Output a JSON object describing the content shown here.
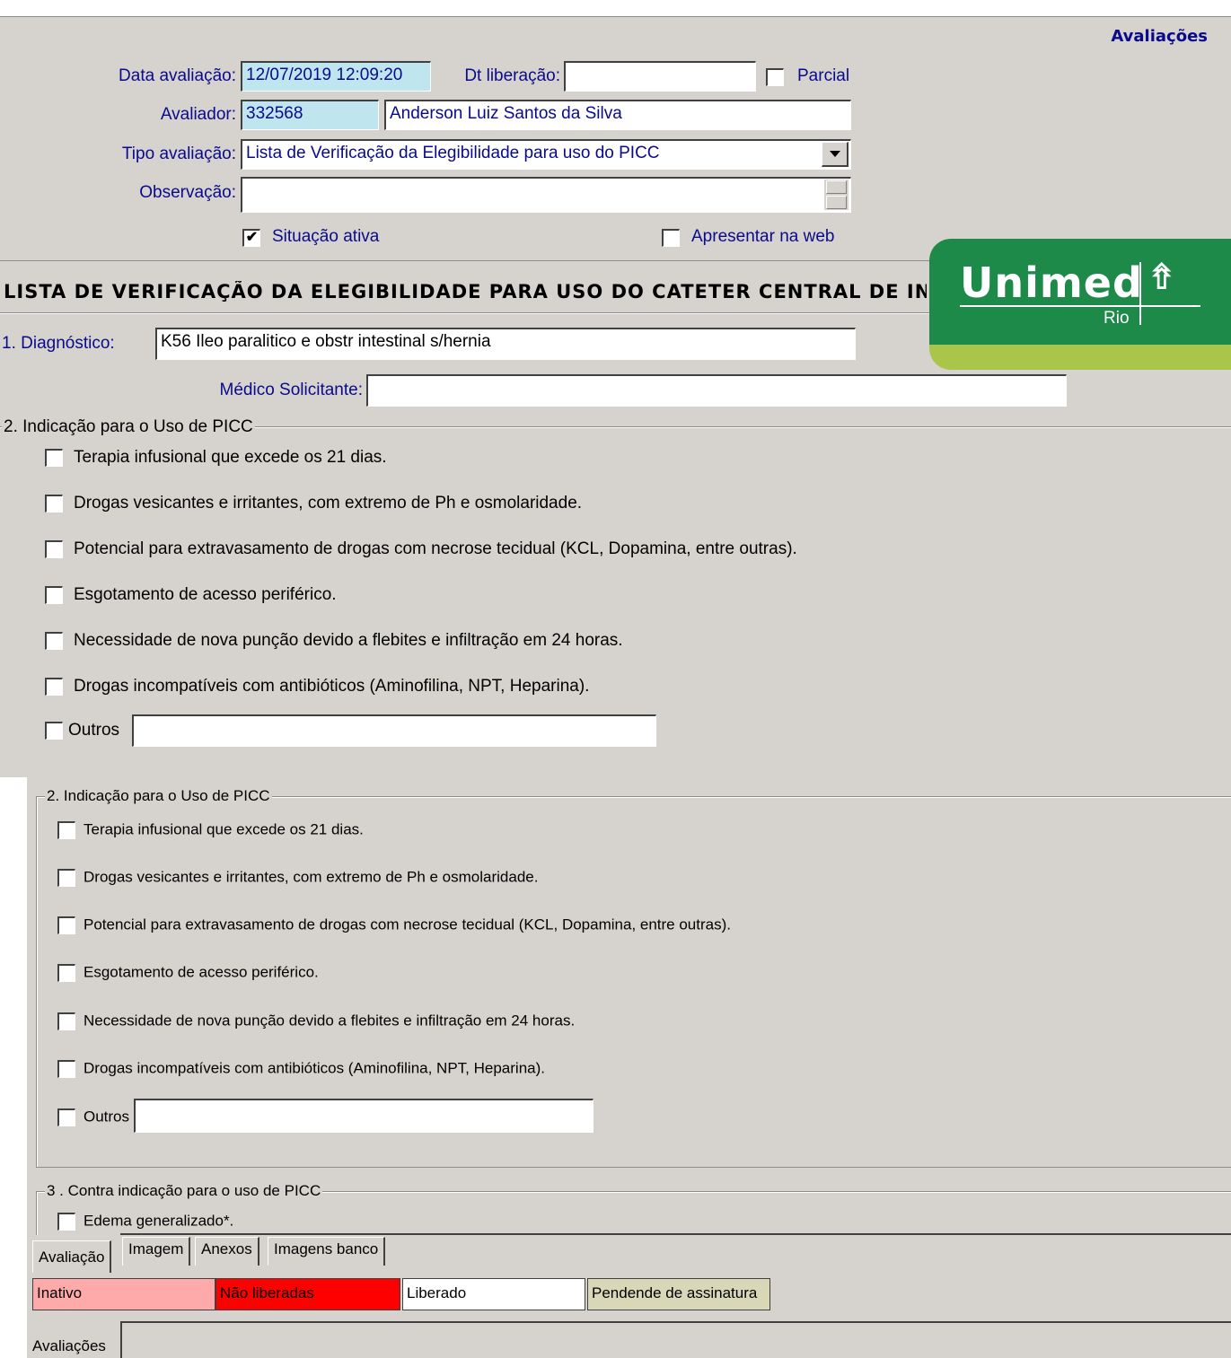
{
  "header": {
    "title": "Avaliações"
  },
  "form": {
    "data_avaliacao_label": "Data avaliação:",
    "data_avaliacao_value": "12/07/2019 12:09:20",
    "dt_liberacao_label": "Dt liberação:",
    "dt_liberacao_value": "",
    "parcial_label": "Parcial",
    "avaliador_label": "Avaliador:",
    "avaliador_code": "332568",
    "avaliador_name": "Anderson Luiz Santos da Silva",
    "tipo_label": "Tipo avaliação:",
    "tipo_value": "Lista de Verificação da Elegibilidade para uso  do PICC",
    "observacao_label": "Observação:",
    "observacao_value": "",
    "situacao_label": "Situação ativa",
    "situacao_checked": "✔",
    "web_label": "Apresentar na web"
  },
  "logo": {
    "brand": "Unimed",
    "city": "Rio",
    "colors": {
      "green": "#1e8a4a",
      "lime": "#a9c64a"
    }
  },
  "section": {
    "title": "LISTA DE VERIFICAÇÃO DA ELEGIBILIDADE PARA  USO DO CATETER CENTRAL DE IN",
    "diagnostico_label": "1. Diagnóstico:",
    "diagnostico_value": "K56   Ileo paralitico e obstr intestinal s/hernia",
    "medico_label": "Médico Solicitante:",
    "medico_value": ""
  },
  "group1": {
    "title": "2. Indicação para o Uso de PICC",
    "items": [
      "Terapia infusional que excede os 21 dias.",
      "Drogas vesicantes e irritantes, com extremo de Ph e osmolaridade.",
      "Potencial para extravasamento de drogas com necrose tecidual (KCL, Dopamina,  entre outras).",
      "Esgotamento de acesso periférico.",
      "Necessidade de nova punção devido a flebites e infiltração em 24 horas.",
      "Drogas incompatíveis com antibióticos (Aminofilina, NPT, Heparina).",
      "Outros"
    ]
  },
  "group2": {
    "title": "2. Indicação para o Uso de PICC",
    "items": [
      "Terapia infusional que excede os 21 dias.",
      "Drogas vesicantes e irritantes, com extremo de Ph e osmolaridade.",
      "Potencial para extravasamento de drogas com necrose tecidual (KCL, Dopamina,  entre outras).",
      "Esgotamento de acesso periférico.",
      "Necessidade de nova punção devido a flebites e infiltração em 24 horas.",
      "Drogas incompatíveis com antibióticos (Aminofilina, NPT, Heparina).",
      "Outros"
    ]
  },
  "group3": {
    "title": "3 . Contra indicação para o uso de PICC",
    "items": [
      "Edema generalizado*."
    ]
  },
  "tabs": [
    "Avaliação",
    "Imagem",
    "Anexos",
    "Imagens banco"
  ],
  "legend": [
    {
      "label": "Inativo",
      "bg": "#ffaaaa"
    },
    {
      "label": "Não liberadas",
      "bg": "#ff0000"
    },
    {
      "label": "Liberado",
      "bg": "#ffffff"
    },
    {
      "label": "Pendende de assinatura",
      "bg": "#d8d8b8"
    }
  ],
  "footer": {
    "label": "Avaliações"
  }
}
